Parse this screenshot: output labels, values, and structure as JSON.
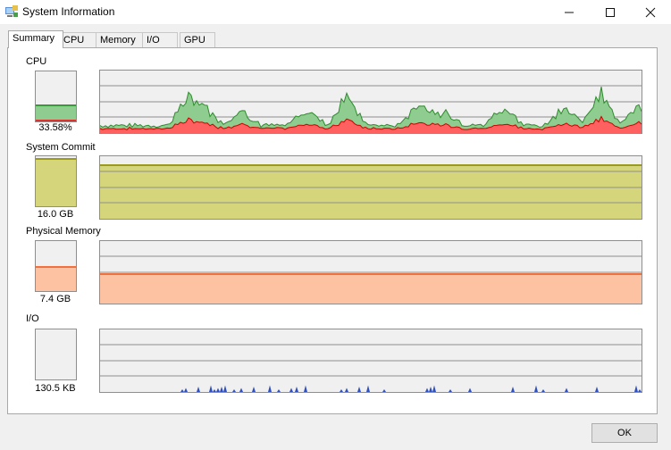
{
  "window": {
    "title": "System Information"
  },
  "tabs": [
    "Summary",
    "CPU",
    "Memory",
    "I/O",
    "GPU"
  ],
  "sections": {
    "cpu": {
      "label": "CPU",
      "value": "33.58%",
      "percent": 33.58,
      "color": "#8fcc8f"
    },
    "commit": {
      "label": "System Commit",
      "value": "16.0 GB",
      "color": "#d5d57c"
    },
    "physical": {
      "label": "Physical Memory",
      "value": "7.4 GB",
      "color": "#fcc2a2"
    },
    "io": {
      "label": "I/O",
      "value": "130.5  KB",
      "color": "#3050c0"
    }
  },
  "buttons": {
    "ok": "OK"
  }
}
